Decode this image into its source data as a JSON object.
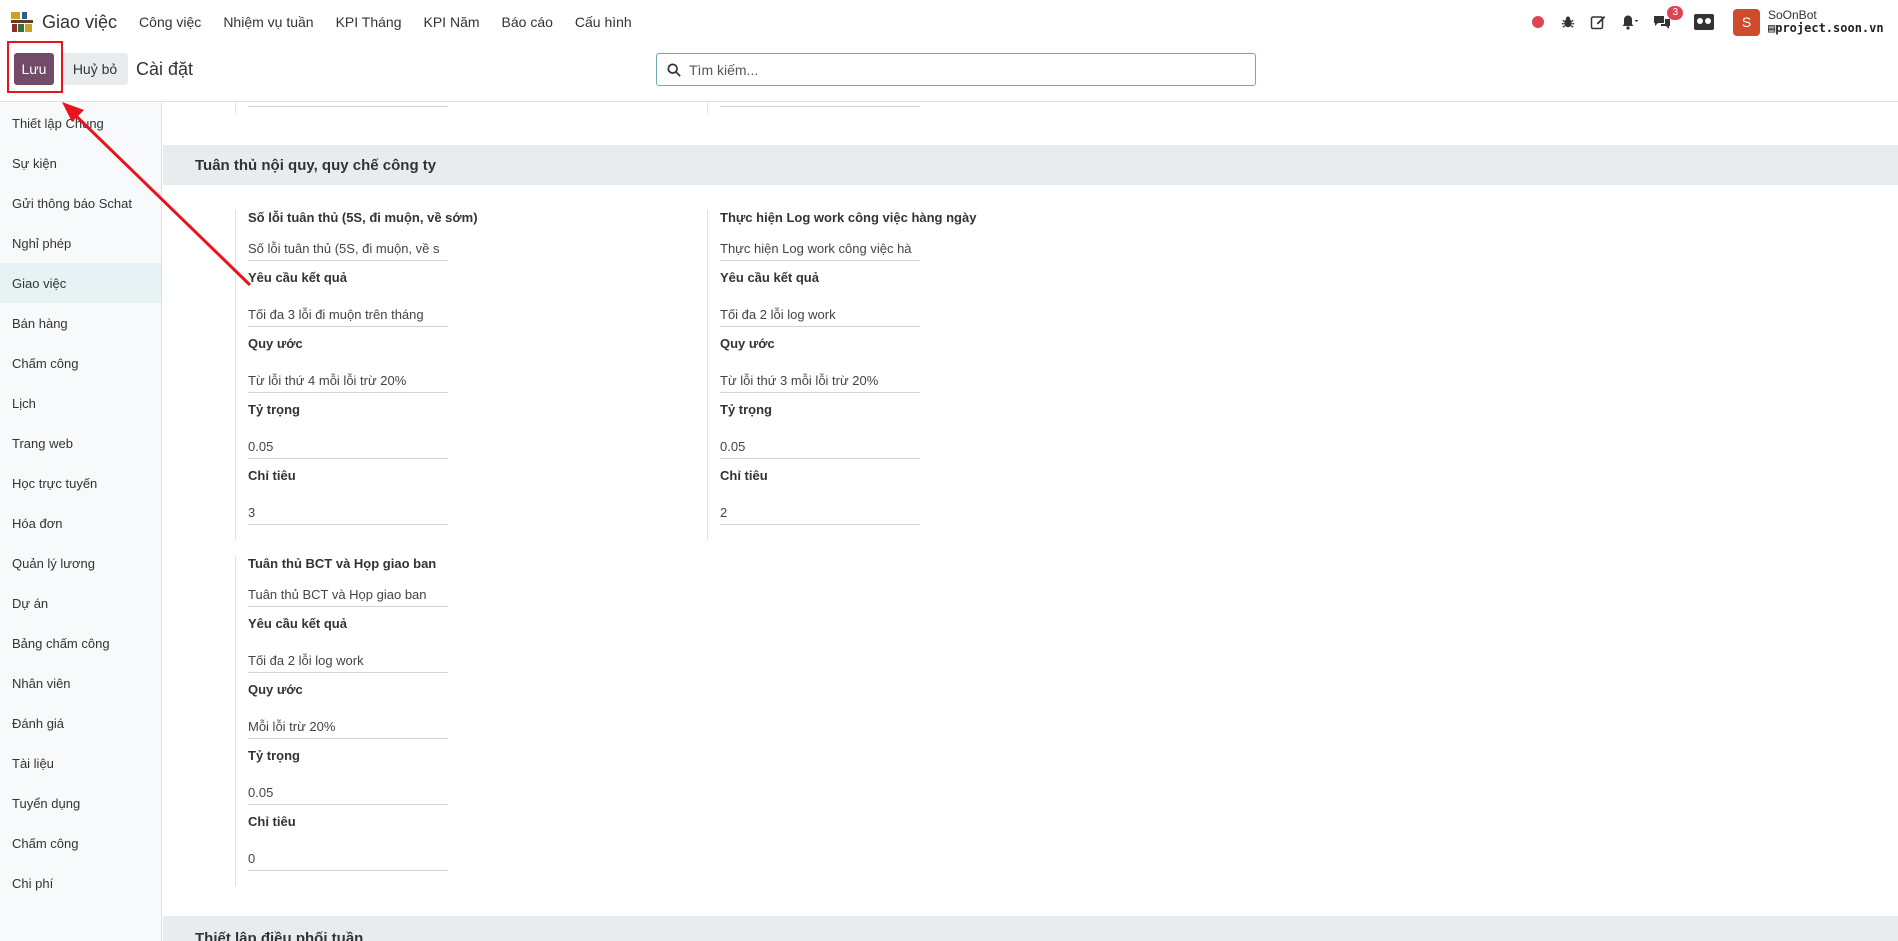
{
  "app": {
    "name": "Giao việc",
    "menu": [
      "Công việc",
      "Nhiệm vụ tuần",
      "KPI Tháng",
      "KPI Năm",
      "Báo cáo",
      "Cấu hình"
    ]
  },
  "systray": {
    "message_count": "3",
    "avatar_initial": "S",
    "user_name": "SoOnBot",
    "database": "project.soon.vn",
    "icons": [
      "record-dot-icon",
      "bug-icon",
      "edit-icon",
      "bell-icon",
      "chat-icon",
      "users-icon"
    ]
  },
  "control": {
    "save_label": "Lưu",
    "discard_label": "Huỷ bỏ",
    "title": "Cài đặt",
    "search_placeholder": "Tìm kiếm..."
  },
  "sidebar": {
    "active": "Giao việc",
    "items": [
      "Thiết lập Chung",
      "Sự kiện",
      "Gửi thông báo Schat",
      "Nghỉ phép",
      "Giao việc",
      "Bán hàng",
      "Chấm công",
      "Lịch",
      "Trang web",
      "Học trực tuyến",
      "Hóa đơn",
      "Quản lý lương",
      "Dự án",
      "Bảng chấm công",
      "Nhân viên",
      "Đánh giá",
      "Tài liệu",
      "Tuyển dụng",
      "Chấm công",
      "Chi phí"
    ]
  },
  "sections": {
    "compliance": {
      "title": "Tuân thủ nội quy, quy chế công ty",
      "groups": [
        {
          "title": "Số lỗi tuân thủ (5S, đi muộn, về sớm)",
          "name_value": "Số lỗi tuân thủ (5S, đi muộn, về s",
          "req_label": "Yêu cầu kết quả",
          "req_value": "Tối đa 3 lỗi đi muộn trên tháng",
          "rule_label": "Quy ước",
          "rule_value": "Từ lỗi thứ 4 mỗi lỗi trừ 20%",
          "weight_label": "Tỷ trọng",
          "weight_value": "0.05",
          "target_label": "Chỉ tiêu",
          "target_value": "3"
        },
        {
          "title": "Thực hiện Log work công việc hàng ngày",
          "name_value": "Thực hiện Log work công việc hà",
          "req_label": "Yêu cầu kết quả",
          "req_value": "Tối đa 2 lỗi log work",
          "rule_label": "Quy ước",
          "rule_value": "Từ lỗi thứ 3 mỗi lỗi trừ 20%",
          "weight_label": "Tỷ trọng",
          "weight_value": "0.05",
          "target_label": "Chỉ tiêu",
          "target_value": "2"
        },
        {
          "title": "Tuân thủ BCT và Họp giao ban",
          "name_value": "Tuân thủ BCT và Họp giao ban",
          "req_label": "Yêu cầu kết quả",
          "req_value": "Tối đa 2 lỗi log work",
          "rule_label": "Quy ước",
          "rule_value": "Mỗi lỗi trừ 20%",
          "weight_label": "Tỷ trọng",
          "weight_value": "0.05",
          "target_label": "Chỉ tiêu",
          "target_value": "0"
        }
      ]
    },
    "weekly": {
      "title": "Thiết lập điều phối tuần"
    }
  },
  "colors": {
    "primary": "#714b67",
    "highlight": "#e8141b",
    "active_bg": "#e6f2f3",
    "section_bg": "#e9ecef"
  }
}
